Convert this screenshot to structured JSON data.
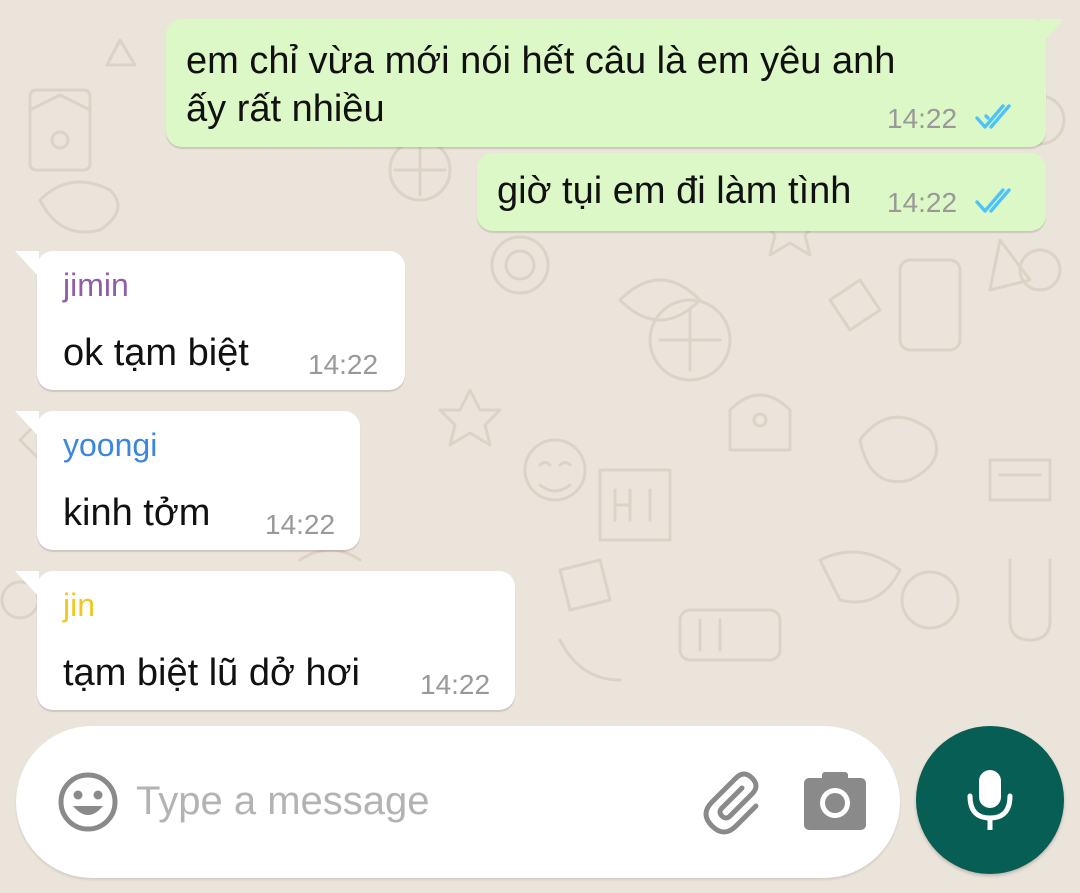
{
  "colors": {
    "outgoing_bubble": "#dcf8c6",
    "incoming_bubble": "#ffffff",
    "read_ticks": "#4fc3f7",
    "mic_button": "#075e54",
    "chat_background": "#ebe4da"
  },
  "messages": [
    {
      "direction": "outgoing",
      "text": "em chỉ vừa mới nói hết câu là em yêu anh\nấy rất nhiều",
      "time": "14:22",
      "status_icon": "double-check-read-icon"
    },
    {
      "direction": "outgoing",
      "text": "giờ tụi em đi làm tình",
      "time": "14:22",
      "status_icon": "double-check-read-icon"
    },
    {
      "direction": "incoming",
      "sender": "jimin",
      "sender_color": "#8e5fa8",
      "text": "ok tạm biệt",
      "time": "14:22"
    },
    {
      "direction": "incoming",
      "sender": "yoongi",
      "sender_color": "#3a86e0",
      "text": "kinh tởm",
      "time": "14:22"
    },
    {
      "direction": "incoming",
      "sender": "jin",
      "sender_color": "#f2c81e",
      "text": "tạm biệt lũ dở hơi",
      "time": "14:22"
    }
  ],
  "composer": {
    "placeholder": "Type a message",
    "value": "",
    "emoji_icon": "emoji-icon",
    "attach_icon": "paperclip-icon",
    "camera_icon": "camera-icon",
    "mic_icon": "microphone-icon"
  }
}
